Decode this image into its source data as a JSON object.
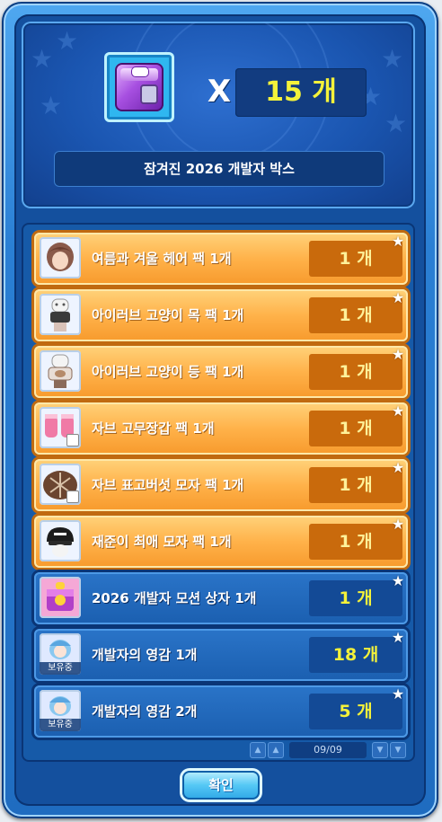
{
  "reward": {
    "multiplier_symbol": "X",
    "count_text": "15 개",
    "box_name": "잠겨진 2026 개발자 박스"
  },
  "items": [
    {
      "name": "여름과 겨울 헤어 팩 1개",
      "qty": "1 개",
      "style": "orange",
      "icon": "hair-icon"
    },
    {
      "name": "아이러브 고양이 목 팩 1개",
      "qty": "1 개",
      "style": "orange",
      "icon": "cat-neck-icon"
    },
    {
      "name": "아이러브 고양이 등 팩 1개",
      "qty": "1 개",
      "style": "orange",
      "icon": "cat-back-icon"
    },
    {
      "name": "자브 고무장갑 팩 1개",
      "qty": "1 개",
      "style": "orange",
      "icon": "rubber-gloves-icon"
    },
    {
      "name": "자브 표고버섯 모자 팩 1개",
      "qty": "1 개",
      "style": "orange",
      "icon": "mushroom-hat-icon"
    },
    {
      "name": "재준이 최애 모자 팩 1개",
      "qty": "1 개",
      "style": "orange",
      "icon": "cap-icon"
    },
    {
      "name": "2026 개발자 모션 상자 1개",
      "qty": "1 개",
      "style": "blue",
      "icon": "motion-box-icon"
    },
    {
      "name": "개발자의 영감 1개",
      "qty": "18 개",
      "style": "blue",
      "icon": "inspiration-icon",
      "badge": "보유중"
    },
    {
      "name": "개발자의 영감 2개",
      "qty": "5 개",
      "style": "blue",
      "icon": "inspiration-icon",
      "badge": "보유중"
    }
  ],
  "pagination": {
    "page_text": "09/09"
  },
  "confirm_label": "확인",
  "colors": {
    "frame": "#2a7fd4",
    "orange_row": "#ffb24a",
    "blue_row": "#1b5fb0",
    "qty_text": "#f4f23a"
  }
}
